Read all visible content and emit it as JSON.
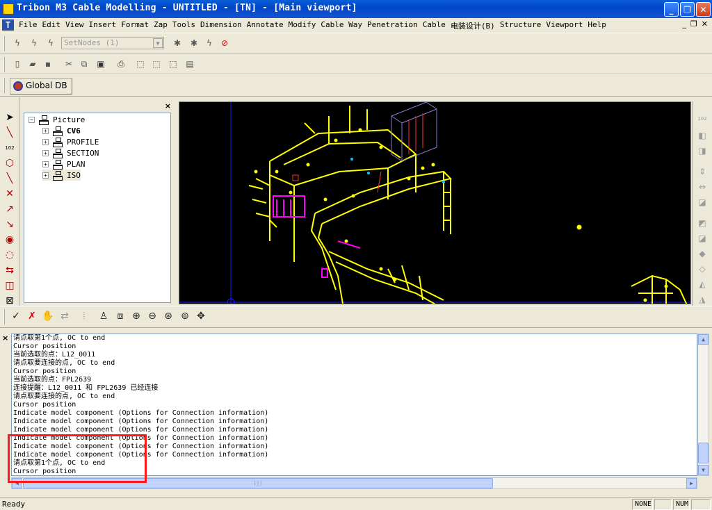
{
  "window": {
    "title": "Tribon M3 Cable Modelling - UNTITLED - [TN] - [Main viewport]",
    "minimize_glyph": "_",
    "maximize_glyph": "❐",
    "close_glyph": "✕"
  },
  "menu": {
    "items": [
      "File",
      "Edit",
      "View",
      "Insert",
      "Format",
      "Zap",
      "Tools",
      "Dimension",
      "Annotate",
      "Modify",
      "Cable Way",
      "Penetration",
      "Cable",
      "电装设计(B)",
      "Structure",
      "Viewport",
      "Help"
    ],
    "mdi_icon_text": "T",
    "mdi_min": "_",
    "mdi_restore": "❐",
    "mdi_close": "✕"
  },
  "toolbar1": {
    "setnodes_value": "SetNodes (1)",
    "icons": [
      "lightning-icon",
      "lightning-disabled-icon",
      "lightning-arrow-icon",
      "bug-icon",
      "bug-lightning-icon",
      "lightning-small-icon",
      "stop-icon"
    ]
  },
  "toolbar2": {
    "icons": [
      "new-file-icon",
      "open-folder-icon",
      "save-icon",
      "cut-icon",
      "copy-icon",
      "paste-icon",
      "print-icon",
      "box-icon",
      "box-open-icon",
      "box-info-icon",
      "layout-icon"
    ]
  },
  "toolbar3": {
    "global_db_label": "Global DB"
  },
  "tree": {
    "close_glyph": "×",
    "root": {
      "label": "Picture",
      "expander": "−"
    },
    "children": [
      {
        "label": "CV6",
        "expander": "+",
        "bold": true
      },
      {
        "label": "PROFILE",
        "expander": "+"
      },
      {
        "label": "SECTION",
        "expander": "+"
      },
      {
        "label": "PLAN",
        "expander": "+"
      },
      {
        "label": "ISO",
        "expander": "+"
      }
    ]
  },
  "console": {
    "close_glyph": "×",
    "lines": [
      "请点取第1个点, OC to end",
      "Cursor position",
      "当前选取的点：L12_0011",
      "请点取要连接的点, OC to end",
      "Cursor position",
      "当前选取的点：FPL2639",
      "连接提醒：L12_0011 和 FPL2639 已经连接",
      "请点取要连接的点, OC to end",
      "Cursor position",
      "Indicate model component (Options for Connection information)",
      "Indicate model component (Options for Connection information)",
      "Indicate model component (Options for Connection information)",
      "Indicate model component (Options for Connection information)",
      "Indicate model component (Options for Connection information)",
      "Indicate model component (Options for Connection information)",
      "请点取第1个点, OC to end",
      "Cursor position"
    ]
  },
  "status": {
    "ready": "Ready",
    "pane_none": "NONE",
    "pane_num": "NUM"
  },
  "colors": {
    "viewport_bg": "#000000",
    "model_yellow": "#ffff00",
    "model_magenta": "#ff00ff",
    "highlight_red": "#ff1a1a",
    "crosshair_blue": "#1a1aff"
  }
}
